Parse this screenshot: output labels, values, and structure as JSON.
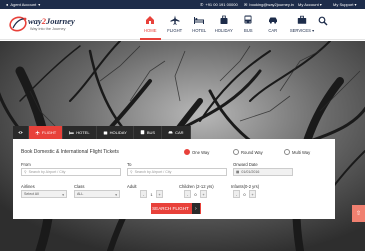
{
  "topbar": {
    "agent_label": "Agent Account",
    "phone": "+91 00 191 00000",
    "email": "booking@way2journey.in",
    "account_label": "My Account",
    "support_label": "My Support"
  },
  "logo": {
    "name_prefix": "way",
    "name_number": "2",
    "name_suffix": "Journey",
    "tagline": "Way into the Journey"
  },
  "nav": {
    "items": [
      {
        "label": "HOME",
        "icon": "home-icon",
        "active": true
      },
      {
        "label": "FLIGHT",
        "icon": "plane-icon",
        "active": false
      },
      {
        "label": "HOTEL",
        "icon": "bed-icon",
        "active": false
      },
      {
        "label": "HOLIDAY",
        "icon": "suitcase-icon",
        "active": false
      },
      {
        "label": "BUS",
        "icon": "bus-icon",
        "active": false
      },
      {
        "label": "CAR",
        "icon": "car-icon",
        "active": false
      },
      {
        "label": "SERVICES ▾",
        "icon": "briefcase-icon",
        "active": false
      }
    ]
  },
  "tabs": [
    {
      "label": "",
      "icon": "eye-icon",
      "active": false
    },
    {
      "label": "FLIGHT",
      "icon": "plane-icon",
      "active": true
    },
    {
      "label": "HOTEL",
      "icon": "bed-icon",
      "active": false
    },
    {
      "label": "HOLIDAY",
      "icon": "suitcase-icon",
      "active": false
    },
    {
      "label": "BUS",
      "icon": "bus-icon",
      "active": false
    },
    {
      "label": "CAR",
      "icon": "car-icon",
      "active": false
    }
  ],
  "form": {
    "title": "Book Domestic & International Flight Tickets",
    "trip_types": [
      {
        "label": "One Way",
        "selected": true
      },
      {
        "label": "Round Way",
        "selected": false
      },
      {
        "label": "Multi Way",
        "selected": false
      }
    ],
    "from_label": "From",
    "from_placeholder": "Search by Airport / City",
    "to_label": "To",
    "to_placeholder": "Search by Airport / City",
    "onward_label": "Onward Date",
    "onward_value": "01/01/2016",
    "airlines_label": "Airlines",
    "airlines_value": "Select All",
    "class_label": "Class",
    "class_value": "ALL",
    "adult_label": "Adult",
    "adult_value": "1",
    "children_label": "Children (2-12 yrs)",
    "children_value": "0",
    "infants_label": "Infants(0-2 yrs)",
    "infants_value": "0",
    "minus": "-",
    "plus": "+",
    "search_label": "SEARCH FLIGHT",
    "search_arrow": "›"
  },
  "colors": {
    "accent": "#e8413a",
    "navy": "#1d2c4a"
  }
}
